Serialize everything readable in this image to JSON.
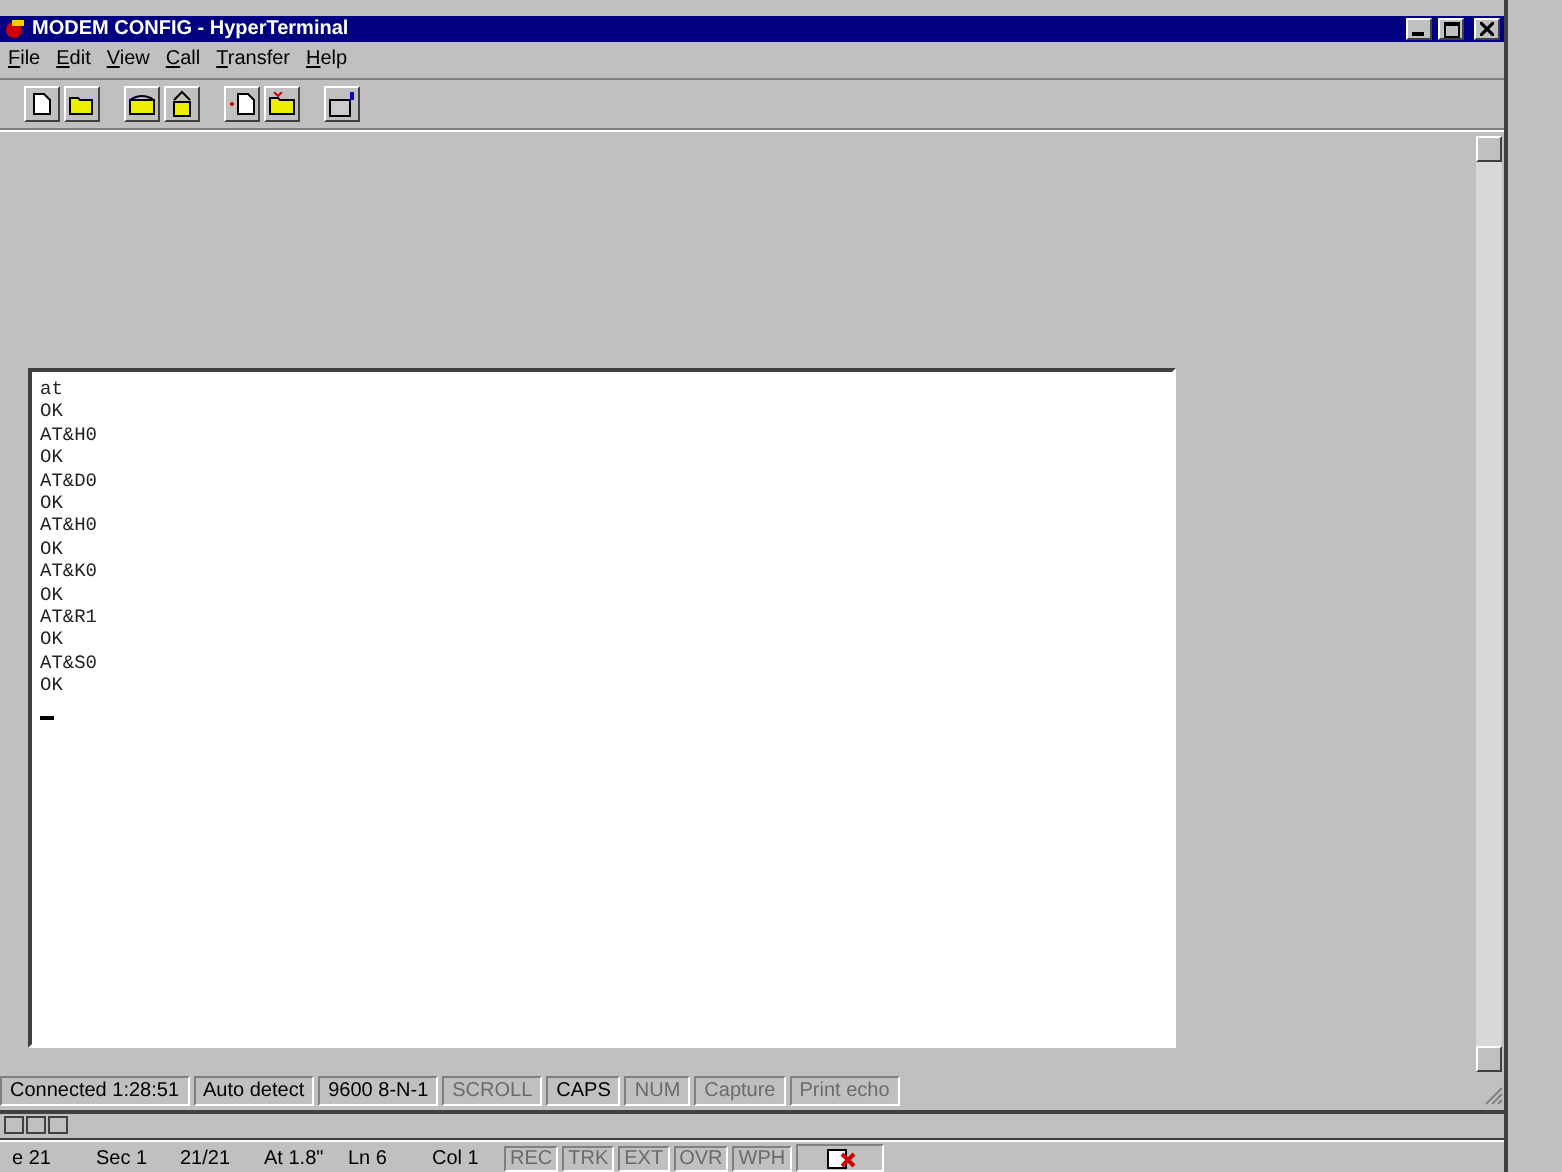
{
  "window": {
    "title": "MODEM CONFIG - HyperTerminal"
  },
  "menu": [
    {
      "label": "File"
    },
    {
      "label": "Edit"
    },
    {
      "label": "View"
    },
    {
      "label": "Call"
    },
    {
      "label": "Transfer"
    },
    {
      "label": "Help"
    }
  ],
  "terminal": {
    "lines": [
      "at",
      "OK",
      "AT&H0",
      "OK",
      "AT&D0",
      "OK",
      "AT&H0",
      "OK",
      "AT&K0",
      "OK",
      "AT&R1",
      "OK",
      "AT&S0",
      "OK"
    ]
  },
  "status_bar": [
    {
      "text": "Connected 1:28:51",
      "disabled": false
    },
    {
      "text": "Auto detect",
      "disabled": false
    },
    {
      "text": "9600 8-N-1",
      "disabled": false
    },
    {
      "text": "SCROLL",
      "disabled": true
    },
    {
      "text": "CAPS",
      "disabled": false
    },
    {
      "text": "NUM",
      "disabled": true
    },
    {
      "text": "Capture",
      "disabled": true
    },
    {
      "text": "Print echo",
      "disabled": true
    }
  ],
  "document_status_bar": {
    "fields": [
      "e 21",
      "Sec 1",
      "21/21",
      "At 1.8\"",
      "Ln 6",
      "Col 1"
    ],
    "modes": [
      {
        "text": "REC",
        "disabled": true
      },
      {
        "text": "TRK",
        "disabled": true
      },
      {
        "text": "EXT",
        "disabled": true
      },
      {
        "text": "OVR",
        "disabled": true
      },
      {
        "text": "WPH",
        "disabled": true
      }
    ]
  }
}
